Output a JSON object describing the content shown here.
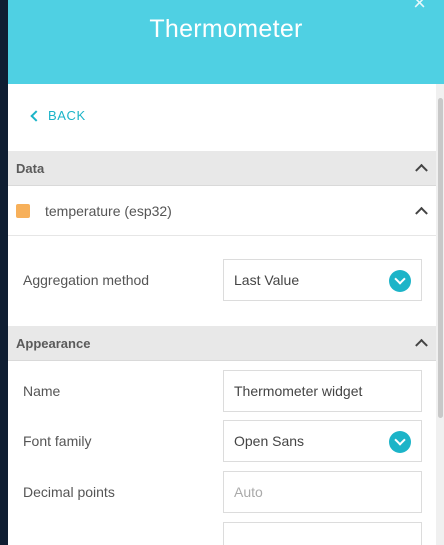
{
  "header": {
    "title": "Thermometer",
    "close_glyph": "×"
  },
  "back": {
    "label": "BACK"
  },
  "data_section": {
    "title": "Data",
    "source": {
      "label": "temperature (esp32)",
      "color": "#f7b05a"
    },
    "aggregation": {
      "label": "Aggregation method",
      "value": "Last Value"
    }
  },
  "appearance_section": {
    "title": "Appearance",
    "name": {
      "label": "Name",
      "value": "Thermometer widget"
    },
    "font_family": {
      "label": "Font family",
      "value": "Open Sans"
    },
    "decimal_points": {
      "label": "Decimal points",
      "placeholder": "Auto"
    }
  },
  "colors": {
    "accent": "#1cb4c8",
    "header_bg": "#4fd0e3",
    "sidebar": "#0f1e32"
  },
  "icons": [
    "close-icon",
    "chevron-left-icon",
    "chevron-up-icon",
    "chevron-down-icon"
  ]
}
